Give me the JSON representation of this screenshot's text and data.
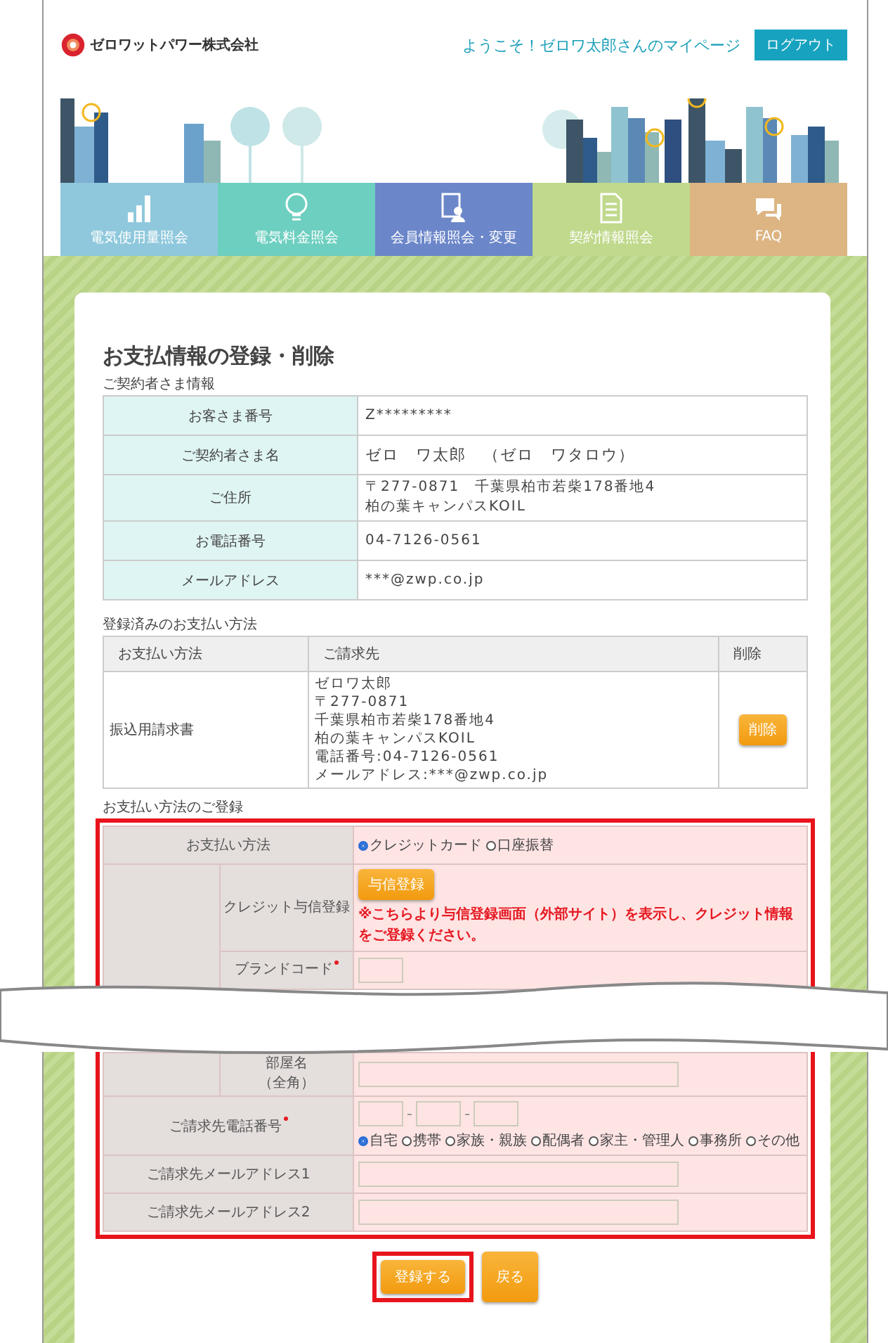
{
  "header": {
    "company": "ゼロワットパワー株式会社",
    "welcome": "ようこそ！ゼロワ太郎さんのマイページ",
    "logout": "ログアウト"
  },
  "nav": [
    {
      "label": "電気使用量照会",
      "kind": "chart",
      "color": "#8fc8dc"
    },
    {
      "label": "電気料金照会",
      "kind": "bulb",
      "color": "#6dcfbf"
    },
    {
      "label": "会員情報照会・変更",
      "kind": "person",
      "color": "#6b86c9"
    },
    {
      "label": "契約情報照会",
      "kind": "document",
      "color": "#c0d98c"
    },
    {
      "label": "FAQ",
      "kind": "chat",
      "color": "#dcb583"
    }
  ],
  "title": "お支払情報の登録・削除",
  "contract": {
    "heading": "ご契約者さま情報",
    "rows": [
      {
        "label": "お客さま番号",
        "lines": [
          "Z*********"
        ]
      },
      {
        "label": "ご契約者さま名",
        "lines": [
          "ゼロ　ワ太郎　（ゼロ　ワタロウ）"
        ]
      },
      {
        "label": "ご住所",
        "lines": [
          "〒277-0871　千葉県柏市若柴178番地4",
          "柏の葉キャンパスKOIL"
        ]
      },
      {
        "label": "お電話番号",
        "lines": [
          "04-7126-0561"
        ]
      },
      {
        "label": "メールアドレス",
        "lines": [
          "***@zwp.co.jp"
        ]
      }
    ]
  },
  "registered": {
    "heading": "登録済みのお支払い方法",
    "columns": [
      "お支払い方法",
      "ご請求先",
      "削除"
    ],
    "rows": [
      {
        "method": "振込用請求書",
        "billing": [
          "ゼロワ太郎",
          "〒277-0871",
          "千葉県柏市若柴178番地4",
          "柏の葉キャンパスKOIL",
          "電話番号:04-7126-0561",
          "メールアドレス:***@zwp.co.jp"
        ],
        "action": "削除"
      }
    ]
  },
  "registration": {
    "heading": "お支払い方法のご登録",
    "payment_label": "お支払い方法",
    "payment_options": [
      {
        "label": "クレジットカード",
        "selected": true
      },
      {
        "label": "口座振替",
        "selected": false
      }
    ],
    "credit_label": "クレジット与信登録",
    "credit_button": "与信登録",
    "credit_note": "※こちらより与信登録画面（外部サイト）を表示し、クレジット情報をご登録ください。",
    "brand_label": "ブランドコード",
    "room_label": "部屋名",
    "room_sub": "（全角）",
    "phone_label": "ご請求先電話番号",
    "phone_types": [
      {
        "label": "自宅",
        "selected": true
      },
      {
        "label": "携帯",
        "selected": false
      },
      {
        "label": "家族・親族",
        "selected": false
      },
      {
        "label": "配偶者",
        "selected": false
      },
      {
        "label": "家主・管理人",
        "selected": false
      },
      {
        "label": "事務所",
        "selected": false
      },
      {
        "label": "その他",
        "selected": false
      }
    ],
    "mail1_label": "ご請求先メールアドレス1",
    "mail2_label": "ご請求先メールアドレス2"
  },
  "buttons": {
    "submit": "登録する",
    "back": "戻る"
  }
}
